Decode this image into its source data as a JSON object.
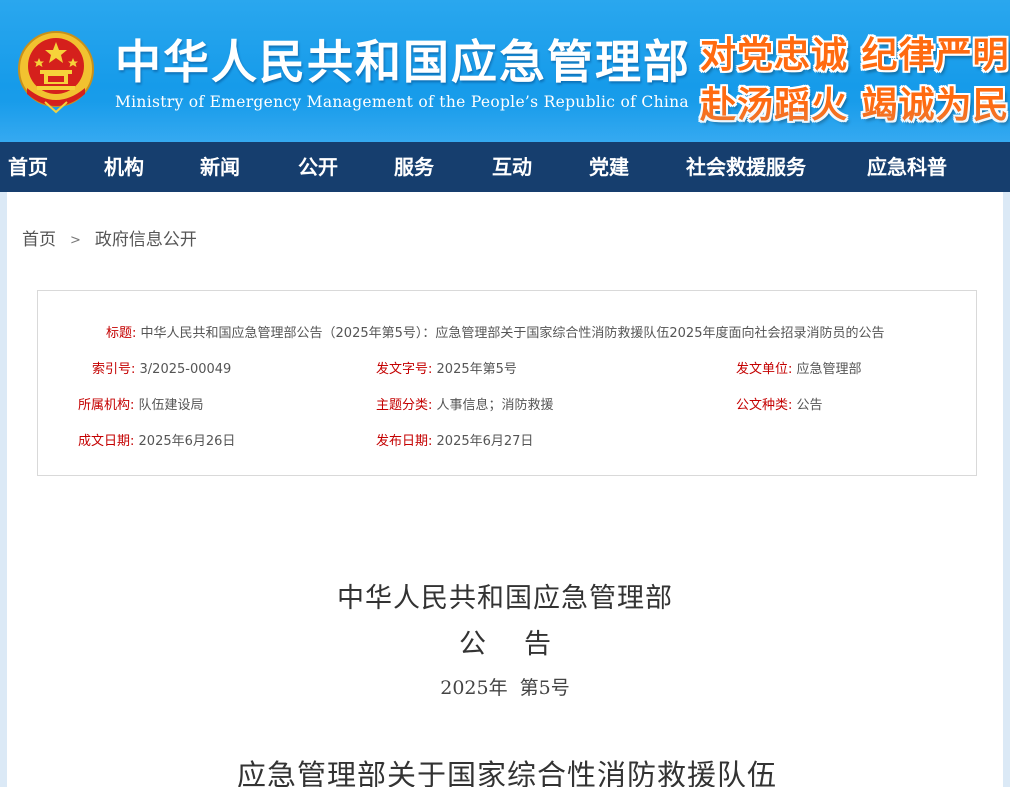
{
  "header": {
    "title": "中华人民共和国应急管理部",
    "subtitle": "Ministry of Emergency Management of the People’s Republic of China",
    "slogan_line1": "对党忠诚 纪律严明",
    "slogan_line2": "赴汤蹈火 竭诚为民",
    "emblem_icon": "national-emblem-icon"
  },
  "nav": {
    "items": [
      {
        "label": "首页"
      },
      {
        "label": "机构"
      },
      {
        "label": "新闻"
      },
      {
        "label": "公开"
      },
      {
        "label": "服务"
      },
      {
        "label": "互动"
      },
      {
        "label": "党建"
      },
      {
        "label": "社会救援服务"
      },
      {
        "label": "应急科普"
      }
    ]
  },
  "breadcrumb": {
    "home": "首页",
    "separator": ">",
    "current": "政府信息公开"
  },
  "meta": {
    "title_label": "标题:",
    "title_value": "中华人民共和国应急管理部公告（2025年第5号）：应急管理部关于国家综合性消防救援队伍2025年度面向社会招录消防员的公告",
    "index_label": "索引号:",
    "index_value": "3/2025-00049",
    "doc_no_label": "发文字号:",
    "doc_no_value": "2025年第5号",
    "issuer_label": "发文单位:",
    "issuer_value": "应急管理部",
    "org_label": "所属机构:",
    "org_value": "队伍建设局",
    "topic_label": "主题分类:",
    "topic_value": "人事信息；消防救援",
    "type_label": "公文种类:",
    "type_value": "公告",
    "created_label": "成文日期:",
    "created_value": "2025年6月26日",
    "published_label": "发布日期:",
    "published_value": "2025年6月27日"
  },
  "document": {
    "org": "中华人民共和国应急管理部",
    "kind": "公告",
    "number": "2025年  第5号",
    "heading": "应急管理部关于国家综合性消防救援队伍"
  },
  "colors": {
    "header_blue": "#169bea",
    "nav_navy": "#163e6e",
    "slogan_orange": "#ff6a10",
    "label_red": "#c40000"
  }
}
